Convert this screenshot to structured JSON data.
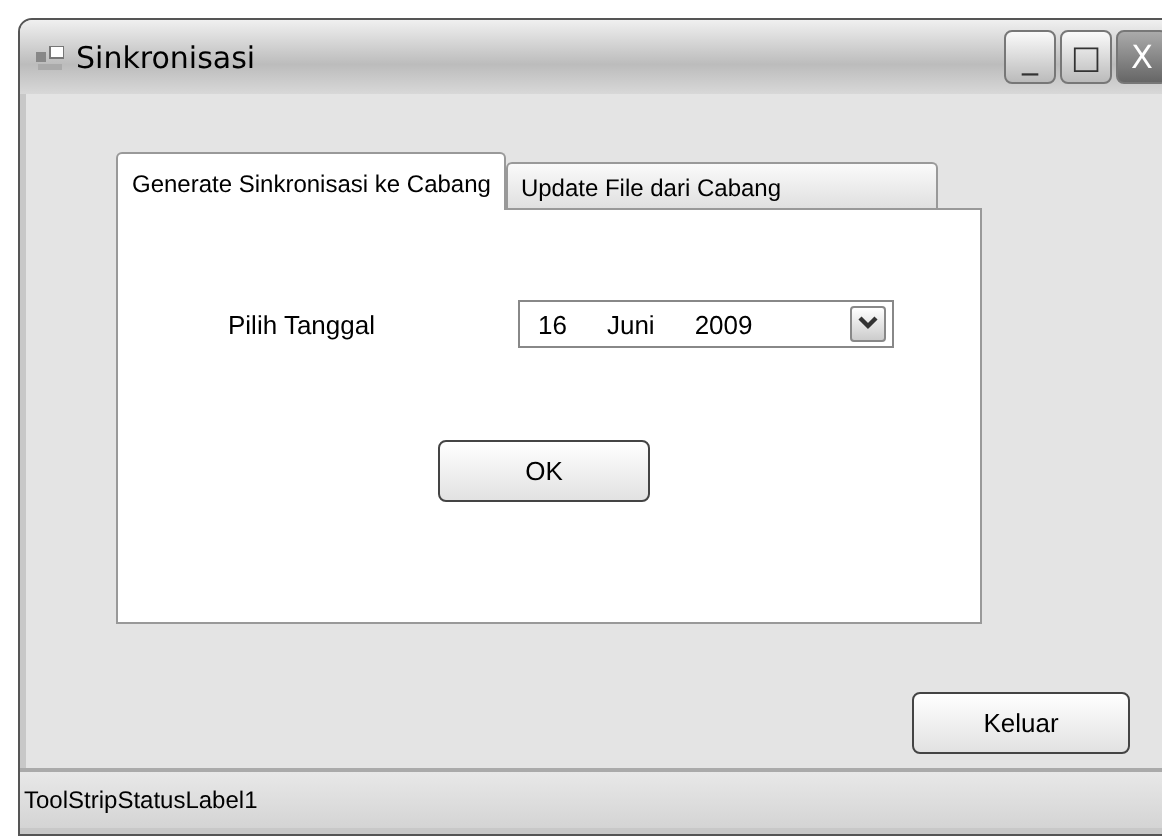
{
  "window": {
    "title": "Sinkronisasi",
    "controls": [
      "_",
      "□",
      "X"
    ]
  },
  "tabs": [
    {
      "label": "Generate Sinkronisasi ke Cabang",
      "selected": true
    },
    {
      "label": "Update File dari Cabang",
      "selected": false
    }
  ],
  "date_field": {
    "label": "Pilih Tanggal",
    "day": "16",
    "month": "Juni",
    "year": "2009"
  },
  "ok_button": "OK",
  "exit_button": "Keluar",
  "status_bar": "ToolStripStatusLabel1"
}
